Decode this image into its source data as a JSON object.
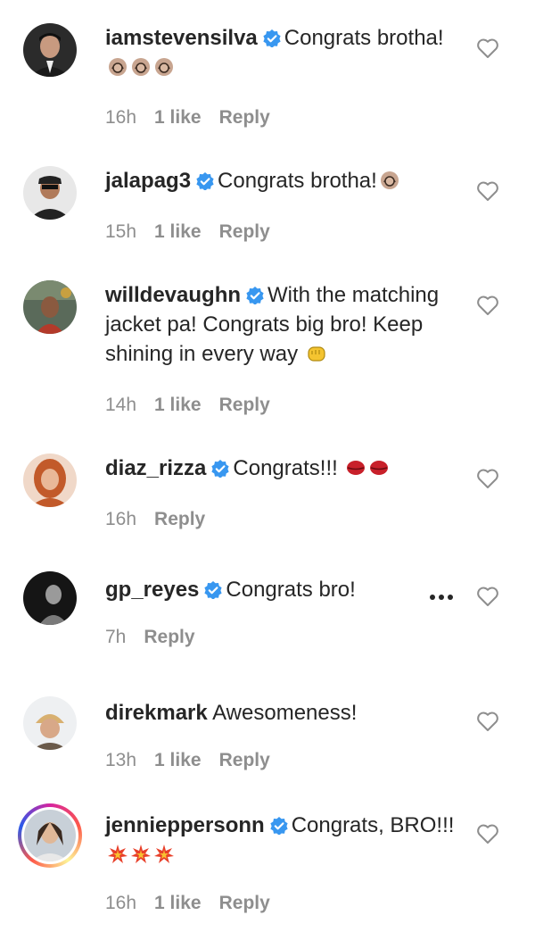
{
  "comments": [
    {
      "username": "iamstevensilva",
      "verified": true,
      "text": "Congrats brotha!",
      "emoji": [
        "clapping-hands",
        "clapping-hands",
        "clapping-hands"
      ],
      "time": "16h",
      "likes": "1 like",
      "reply": "Reply"
    },
    {
      "username": "jalapag3",
      "verified": true,
      "text": "Congrats brotha!",
      "emoji": [
        "clapping-hands"
      ],
      "time": "15h",
      "likes": "1 like",
      "reply": "Reply"
    },
    {
      "username": "willdevaughn",
      "verified": true,
      "text": "With the matching jacket pa! Congrats big bro! Keep shining in every way",
      "emoji": [
        "fist-bump"
      ],
      "time": "14h",
      "likes": "1 like",
      "reply": "Reply"
    },
    {
      "username": "diaz_rizza",
      "verified": true,
      "text": "Congrats!!!",
      "emoji": [
        "kiss-mark",
        "kiss-mark"
      ],
      "time": "16h",
      "likes": "",
      "reply": "Reply"
    },
    {
      "username": "gp_reyes",
      "verified": true,
      "text": "Congrats bro!",
      "emoji": [],
      "time": "7h",
      "likes": "",
      "reply": "Reply",
      "more_icon": "ellipsis-icon"
    },
    {
      "username": "direkmark",
      "verified": false,
      "text": "Awesomeness!",
      "emoji": [],
      "time": "13h",
      "likes": "1 like",
      "reply": "Reply"
    },
    {
      "username": "jennieppersonn",
      "verified": true,
      "text": "Congrats, BRO!!!",
      "emoji": [
        "collision",
        "collision",
        "collision"
      ],
      "time": "16h",
      "likes": "1 like",
      "reply": "Reply",
      "story_ring": true
    }
  ],
  "colors": {
    "text": "#262626",
    "meta": "#8e8e8e",
    "verified": "#3897f0",
    "heart_outline": "#8e8e8e"
  }
}
